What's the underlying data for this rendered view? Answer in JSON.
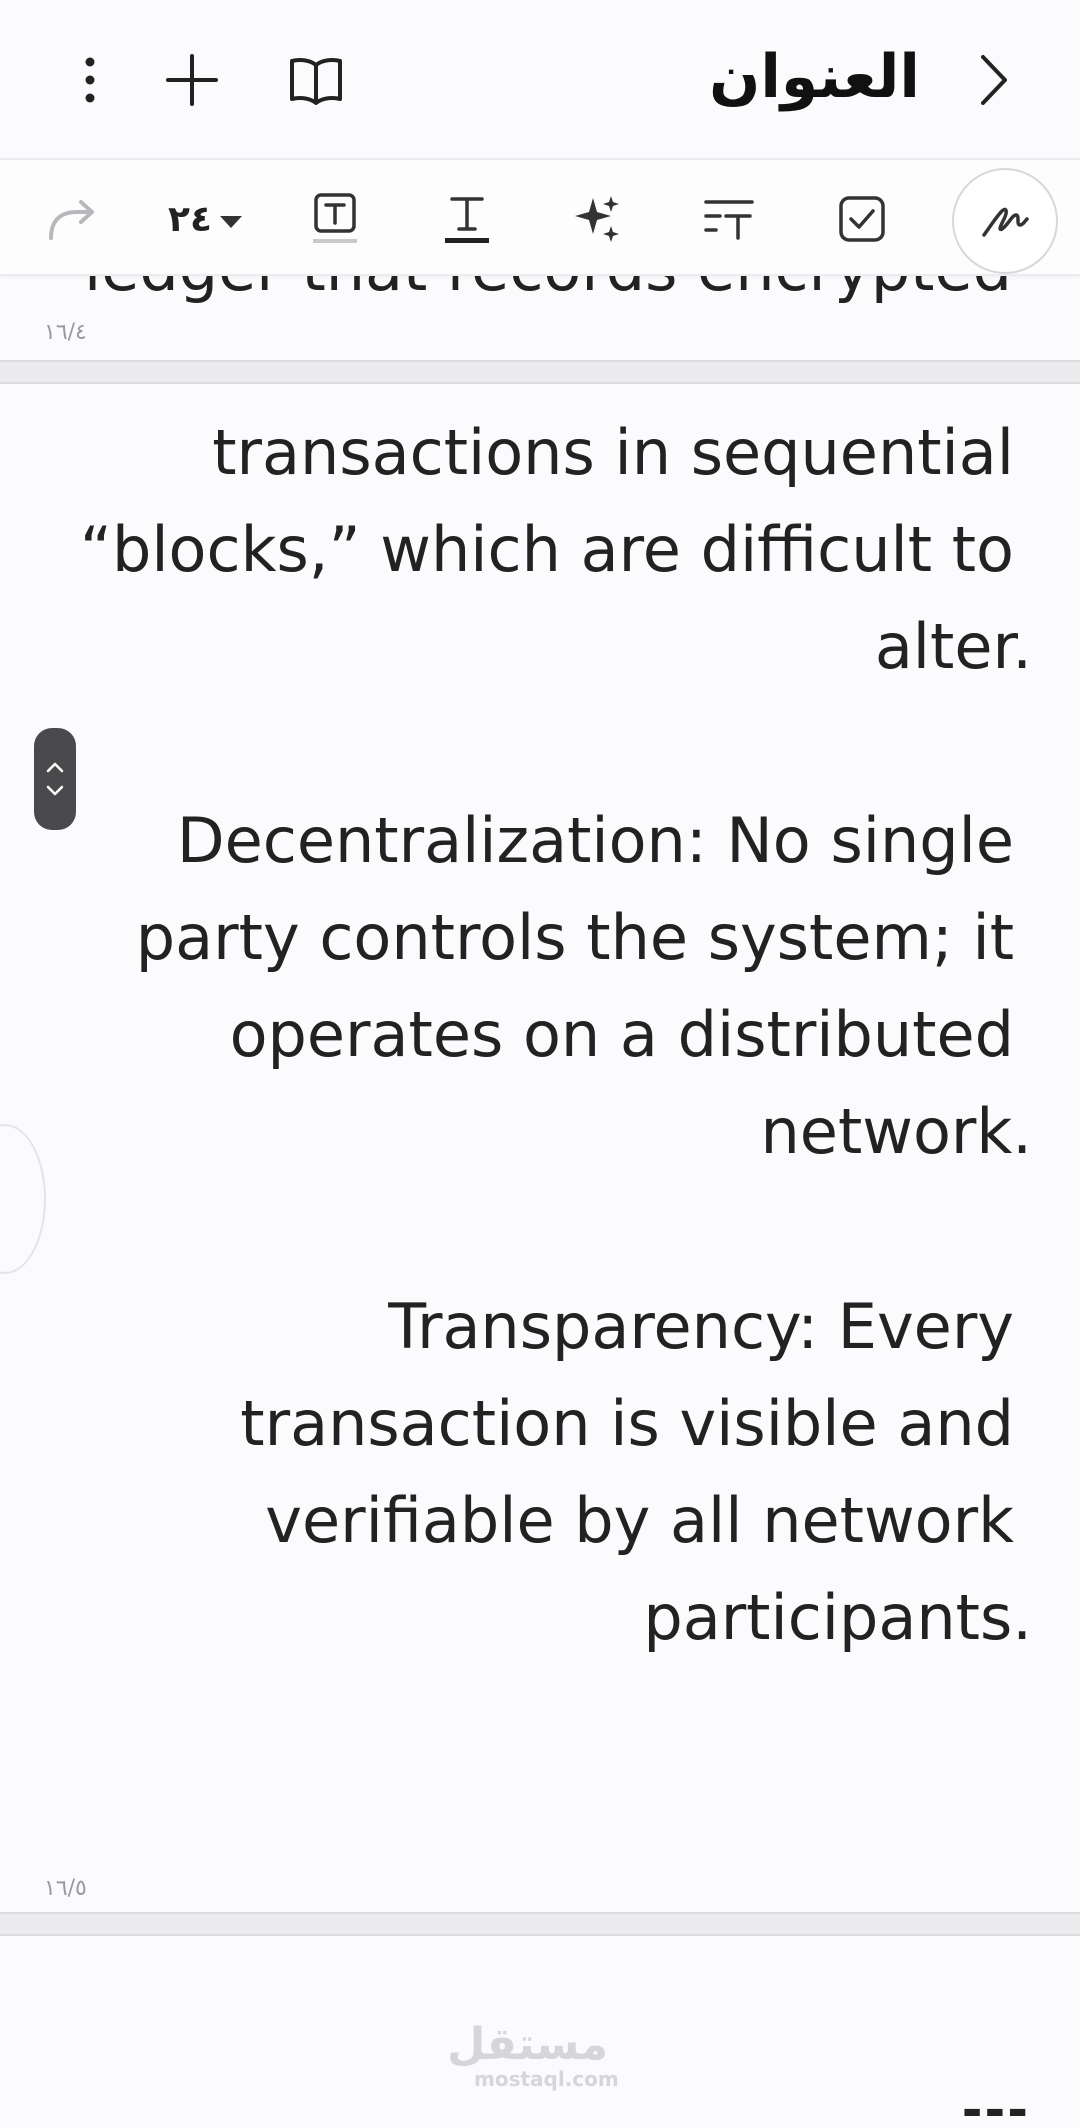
{
  "header": {
    "title": "العنوان",
    "icons": {
      "back": "chevron-right-icon",
      "reader": "book-open-icon",
      "add": "plus-icon",
      "more": "more-vertical-icon"
    }
  },
  "toolbar": {
    "font_size": "٢٤",
    "icons": [
      "redo-icon",
      "text-box-icon",
      "text-format-icon",
      "ai-sparkle-icon",
      "text-style-icon",
      "checkbox-icon",
      "pen-icon"
    ]
  },
  "pages": {
    "prev": {
      "text_fragment": "ledger that records encrypted",
      "number": "١٦/٤"
    },
    "current": {
      "number": "١٦/٥",
      "paragraphs": [
        {
          "lines": [
            "transactions in sequential",
            "“blocks,” which are difficult to",
            "alter."
          ]
        },
        {
          "lines": [
            "Decentralization: No single",
            "party controls the system; it",
            "operates on a distributed",
            "network."
          ]
        },
        {
          "lines": [
            "Transparency: Every",
            "transaction is visible and",
            "verifiable by all network",
            "participants."
          ]
        }
      ]
    },
    "next": {
      "fragment": "---"
    }
  },
  "watermark": {
    "arabic": "مستقل",
    "latin": "mostaql.com"
  },
  "colors": {
    "background": "#fbfbfd",
    "text": "#222222",
    "separator": "#ececef",
    "handle": "#4a4a4c"
  }
}
